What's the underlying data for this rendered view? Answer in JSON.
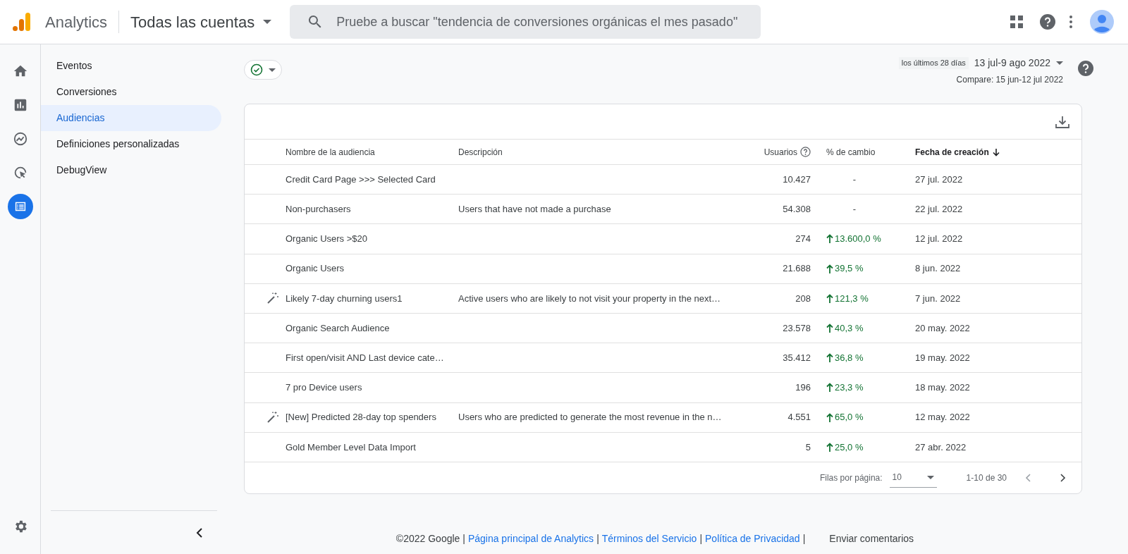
{
  "header": {
    "product": "Analytics",
    "account": "Todas las cuentas",
    "search": {
      "placeholder": "Pruebe a buscar \"tendencia de conversiones orgánicas el mes pasado\""
    }
  },
  "rail": [
    {
      "selected": false
    },
    {
      "selected": false
    },
    {
      "selected": false
    },
    {
      "selected": false
    },
    {
      "selected": true
    }
  ],
  "sidebar": {
    "items": [
      {
        "label": "Eventos",
        "selected": false
      },
      {
        "label": "Conversiones",
        "selected": false
      },
      {
        "label": "Audiencias",
        "selected": true
      },
      {
        "label": "Definiciones personalizadas",
        "selected": false
      },
      {
        "label": "DebugView",
        "selected": false
      }
    ]
  },
  "date_range": {
    "preset": "los últimos 28 días",
    "range": "13 jul-9 ago 2022",
    "compare": "Compare: 15 jun-12 jul 2022"
  },
  "table": {
    "columns": [
      "Nombre de la audiencia",
      "Descripción",
      "Usuarios",
      "% de cambio",
      "Fecha de creación"
    ],
    "rows": [
      {
        "predictive": false,
        "name": "Credit Card Page >>> Selected Card",
        "description": "",
        "users": "10.427",
        "change": "-",
        "rising": false,
        "created": "27 jul. 2022"
      },
      {
        "predictive": false,
        "name": "Non-purchasers",
        "description": "Users that have not made a purchase",
        "users": "54.308",
        "change": "-",
        "rising": false,
        "created": "22 jul. 2022"
      },
      {
        "predictive": false,
        "name": "Organic Users >$20",
        "description": "",
        "users": "274",
        "change": "13.600,0 %",
        "rising": true,
        "created": "12 jul. 2022"
      },
      {
        "predictive": false,
        "name": "Organic Users",
        "description": "",
        "users": "21.688",
        "change": "39,5 %",
        "rising": true,
        "created": "8 jun. 2022"
      },
      {
        "predictive": true,
        "name": "Likely 7-day churning users1",
        "description": "Active users who are likely to not visit your property in the next…",
        "users": "208",
        "change": "121,3 %",
        "rising": true,
        "created": "7 jun. 2022"
      },
      {
        "predictive": false,
        "name": "Organic Search Audience",
        "description": "",
        "users": "23.578",
        "change": "40,3 %",
        "rising": true,
        "created": "20 may. 2022"
      },
      {
        "predictive": false,
        "name": "First open/visit AND Last device cate…",
        "description": "",
        "users": "35.412",
        "change": "36,8 %",
        "rising": true,
        "created": "19 may. 2022"
      },
      {
        "predictive": false,
        "name": "7 pro Device users",
        "description": "",
        "users": "196",
        "change": "23,3 %",
        "rising": true,
        "created": "18 may. 2022"
      },
      {
        "predictive": true,
        "name": "[New] Predicted 28-day top spenders",
        "description": "Users who are predicted to generate the most revenue in the n…",
        "users": "4.551",
        "change": "65,0 %",
        "rising": true,
        "created": "12 may. 2022"
      },
      {
        "predictive": false,
        "name": "Gold Member Level Data Import",
        "description": "",
        "users": "5",
        "change": "25,0 %",
        "rising": true,
        "created": "27 abr. 2022"
      }
    ],
    "pagination": {
      "rows_label": "Filas por página:",
      "rows_value": "10",
      "range": "1-10 de 30"
    }
  },
  "footer": {
    "copyright": "©2022 Google |",
    "links": [
      "Página principal de Analytics",
      "Términos del Servicio",
      "Política de Privacidad"
    ],
    "separators": [
      "|",
      "|",
      "|"
    ],
    "feedback": "Enviar comentarios"
  }
}
